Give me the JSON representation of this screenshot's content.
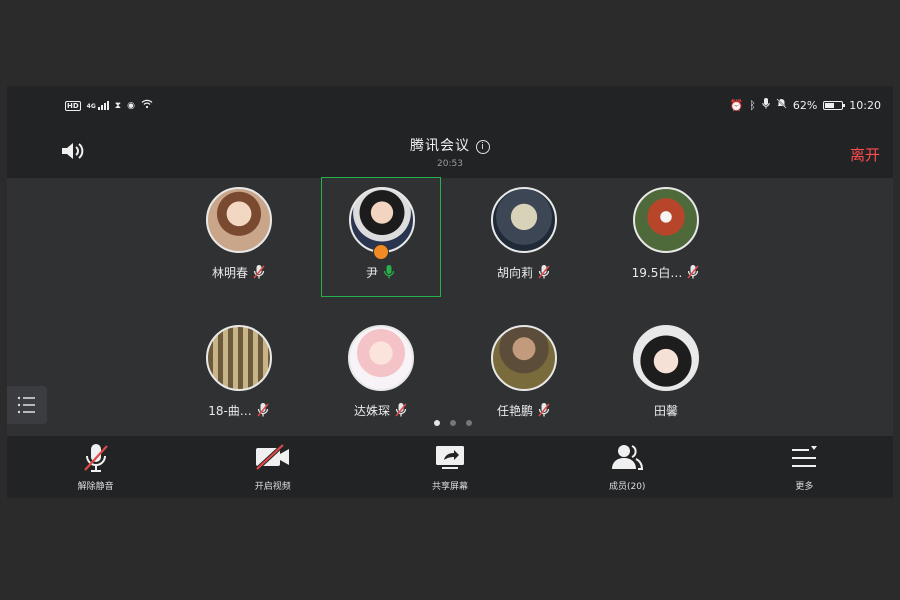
{
  "status_bar": {
    "left_badge": "HD",
    "signal_label": "4G",
    "battery_percent": "62%",
    "battery_level": 0.62,
    "time": "10:20"
  },
  "header": {
    "title": "腾讯会议",
    "timer": "20:53",
    "leave_label": "离开",
    "leave_color": "#ff4b4b"
  },
  "participants": [
    {
      "name": "林明春",
      "mic": "muted"
    },
    {
      "name": "尹",
      "mic": "active",
      "host": true,
      "speaking": true
    },
    {
      "name": "胡向莉",
      "mic": "muted"
    },
    {
      "name": "19.5白…",
      "mic": "muted"
    },
    {
      "name": "18-曲…",
      "mic": "muted"
    },
    {
      "name": "达姝琛",
      "mic": "muted"
    },
    {
      "name": "任艳鹏",
      "mic": "muted"
    },
    {
      "name": "田馨",
      "mic": "none"
    }
  ],
  "pager": {
    "pages": 3,
    "current": 1
  },
  "toolbar": {
    "unmute_label": "解除静音",
    "video_label": "开启视频",
    "share_label": "共享屏幕",
    "members_label": "成员(20)",
    "more_label": "更多"
  },
  "colors": {
    "accent_green": "#27b14a",
    "muted_red": "#e04848",
    "host_orange": "#f08a24"
  }
}
